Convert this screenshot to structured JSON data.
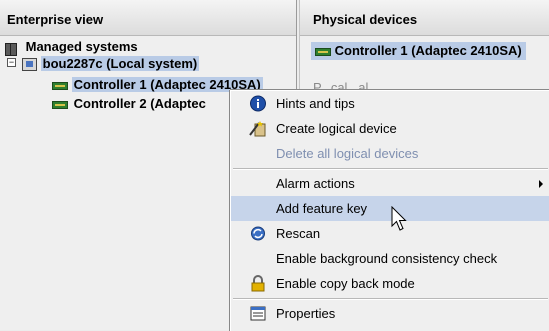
{
  "left_pane": {
    "title": "Enterprise view",
    "tree": {
      "root": "Managed systems",
      "system": "bou2287c (Local system)",
      "controllers": [
        "Controller 1 (Adaptec 2410SA)",
        "Controller 2 (Adaptec"
      ]
    }
  },
  "right_pane": {
    "title": "Physical devices",
    "selected_controller": "Controller 1 (Adaptec 2410SA)",
    "obscured_text": "P...cal ..al..."
  },
  "context_menu": {
    "items": [
      {
        "label": "Hints and tips",
        "icon": "info-icon"
      },
      {
        "label": "Create logical device",
        "icon": "magic-wand-icon"
      },
      {
        "label": "Delete all logical devices",
        "icon": "none",
        "disabled": true
      },
      {
        "label": "Alarm actions",
        "icon": "none",
        "submenu": true
      },
      {
        "label": "Add feature key",
        "icon": "none",
        "highlighted": true
      },
      {
        "label": "Rescan",
        "icon": "rescan-icon"
      },
      {
        "label": "Enable background consistency check",
        "icon": "none"
      },
      {
        "label": "Enable copy back mode",
        "icon": "lock-icon"
      },
      {
        "label": "Properties",
        "icon": "properties-icon"
      }
    ]
  },
  "colors": {
    "selection": "#b9cbe6",
    "menu_highlight": "#c6d4ea",
    "disabled_text": "#7f8fb0"
  }
}
